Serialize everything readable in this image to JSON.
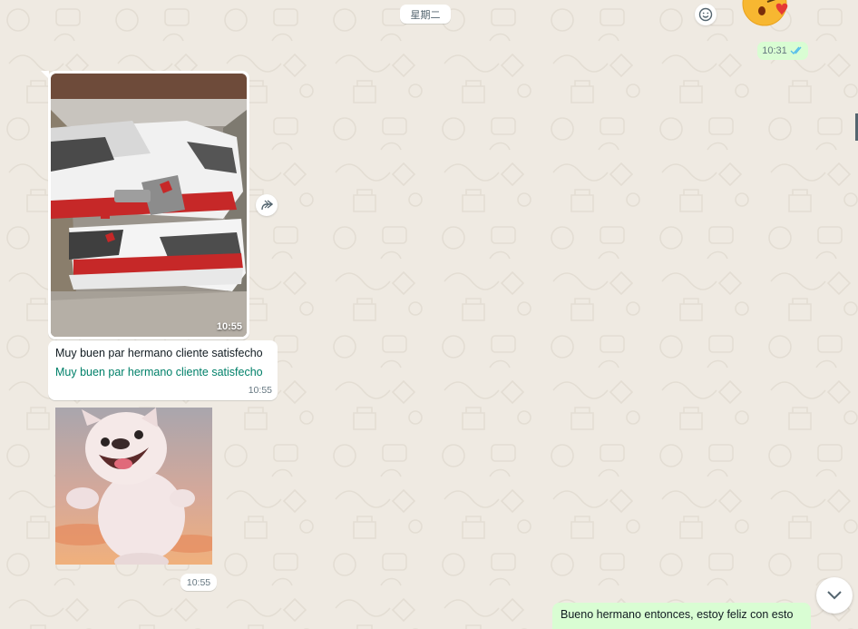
{
  "chat": {
    "date_divider": "星期二",
    "previous_outgoing": {
      "time": "10:31",
      "status_icon": "double-check-read-icon",
      "reaction_icon": "smiley-icon",
      "sticker": "kissing-face-with-heart-emoji"
    },
    "incoming": {
      "image_message": {
        "time": "10:55",
        "content": "sneakers-photo",
        "forward_icon": "forward-icon"
      },
      "text_message": {
        "text": "Muy buen par hermano cliente satisfecho",
        "translation": "Muy buen par hermano cliente satisfecho",
        "time": "10:55"
      },
      "sticker_message": {
        "content": "dancing-bulldog-sticker",
        "time": "10:55"
      }
    },
    "outgoing_last": {
      "text": "Bueno hermano entonces, estoy feliz con esto"
    },
    "scroll_button_icon": "chevron-down-icon"
  },
  "colors": {
    "background": "#efeae2",
    "outgoing_bubble": "#d9fdd3",
    "incoming_bubble": "#ffffff",
    "link_green": "#008069",
    "read_tick": "#53bdeb"
  }
}
